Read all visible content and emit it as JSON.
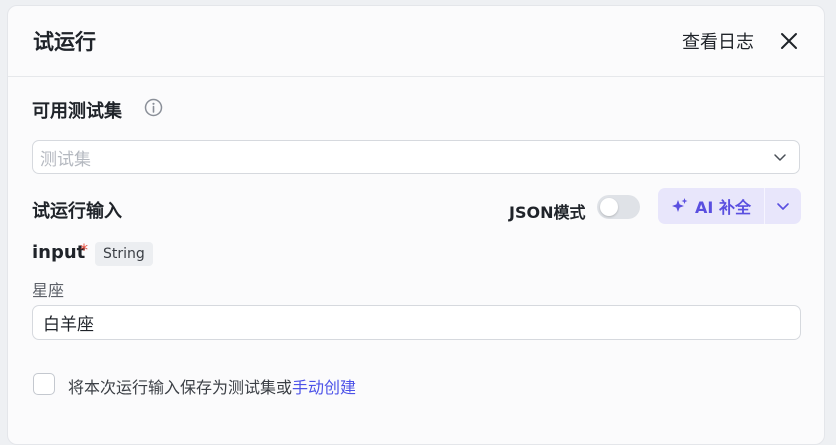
{
  "header": {
    "title": "试运行",
    "view_logs": "查看日志"
  },
  "testset": {
    "label": "可用测试集",
    "placeholder": "测试集"
  },
  "run_input": {
    "label": "试运行输入",
    "json_mode_label": "JSON模式",
    "json_mode_on": false,
    "ai_complete_label": "AI 补全"
  },
  "param": {
    "name": "input",
    "required_mark": "*",
    "type": "String",
    "description": "星座",
    "value": "白羊座"
  },
  "save": {
    "text": "将本次运行输入保存为测试集或",
    "link": "手动创建",
    "checked": false
  },
  "colors": {
    "accent": "#4d53e8",
    "ai_bg": "#e8e6fb",
    "required": "#e5493a"
  },
  "icons": [
    "close-icon",
    "info-icon",
    "chevron-down-icon",
    "sparkle-icon"
  ]
}
